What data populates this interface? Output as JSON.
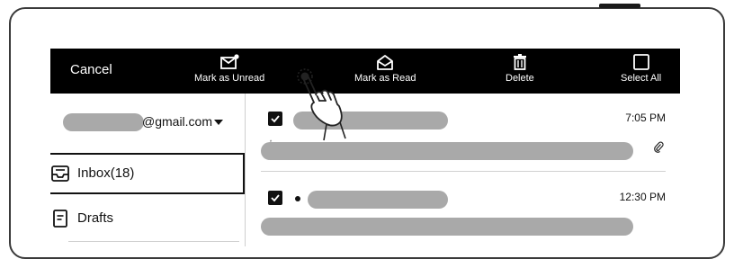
{
  "toolbar": {
    "cancel_label": "Cancel",
    "mark_unread_label": "Mark as Unread",
    "mark_read_label": "Mark as Read",
    "delete_label": "Delete",
    "select_all_label": "Select All"
  },
  "sidebar": {
    "account_domain": "@gmail.com",
    "folders": [
      {
        "label": "Inbox(18)",
        "icon": "inbox-icon",
        "selected": true
      },
      {
        "label": "Drafts",
        "icon": "drafts-icon",
        "selected": false
      }
    ]
  },
  "messages": [
    {
      "time": "7:05 PM",
      "checked": true,
      "unread": false,
      "has_attachment": true,
      "preview_fragment": "t"
    },
    {
      "time": "12:30 PM",
      "checked": true,
      "unread": true,
      "has_attachment": false
    }
  ],
  "colors": {
    "toolbar_bg": "#000000",
    "redaction": "#a9a9a9",
    "frame": "#3a3a3a"
  }
}
